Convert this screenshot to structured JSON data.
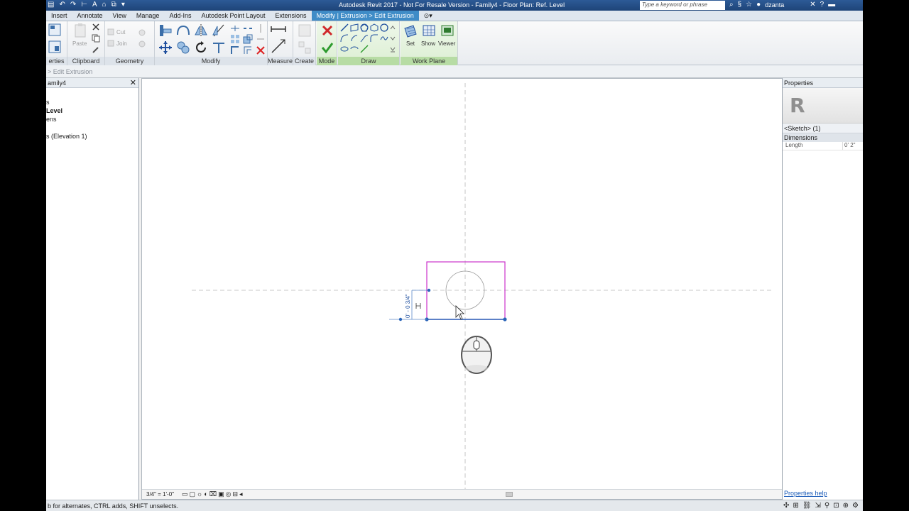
{
  "window": {
    "title": "Autodesk Revit 2017 - Not For Resale Version -  Family4 - Floor Plan: Ref. Level",
    "search_placeholder": "Type a keyword or phrase",
    "user": "dzanta"
  },
  "tabs": [
    {
      "label": "Insert"
    },
    {
      "label": "Annotate"
    },
    {
      "label": "View"
    },
    {
      "label": "Manage"
    },
    {
      "label": "Add-Ins"
    },
    {
      "label": "Autodesk Point Layout"
    },
    {
      "label": "Extensions"
    },
    {
      "label": "Modify | Extrusion > Edit Extrusion",
      "active": true
    }
  ],
  "ribbon": {
    "panels": {
      "properties": "erties",
      "clipboard": "Clipboard",
      "geometry": "Geometry",
      "modify": "Modify",
      "measure": "Measure",
      "create": "Create",
      "mode": "Mode",
      "draw": "Draw",
      "work_plane": "Work Plane"
    },
    "buttons": {
      "paste": "Paste",
      "cut": "Cut",
      "join": "Join",
      "set": "Set",
      "show": "Show",
      "viewer": "Viewer"
    }
  },
  "options_bar": {
    "breadcrumb": "  > Edit Extrusion"
  },
  "project_browser": {
    "title": "amily4",
    "items": [
      "s",
      "Level",
      "ens",
      "",
      "s (Elevation 1)",
      ""
    ]
  },
  "view": {
    "scale": "3/4\" = 1'-0\"",
    "dimension": "0' - 0 3/4\""
  },
  "properties": {
    "title": "Properties",
    "logo": "R",
    "type_selector": "<Sketch> (1)",
    "group": "Dimensions",
    "rows": [
      {
        "key": "Length",
        "value": "0'  2\""
      }
    ],
    "help": "Properties help"
  },
  "status": {
    "text": "b for alternates, CTRL adds, SHIFT unselects."
  },
  "colors": {
    "sketch": "#cc33cc",
    "accent": "#3f8cc7",
    "title_bar": "#1e4478",
    "dim": "#1f4f9e"
  }
}
